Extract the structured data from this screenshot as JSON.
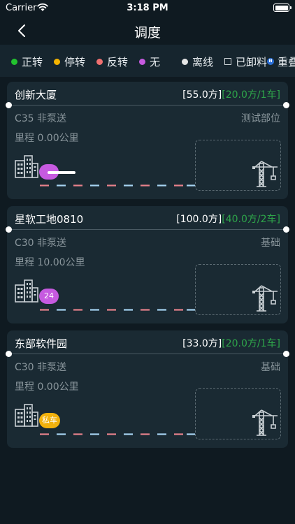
{
  "status_bar": {
    "carrier": "Carrier",
    "time": "3:18 PM"
  },
  "nav": {
    "title": "调度"
  },
  "legend": {
    "items": [
      {
        "label": "正转",
        "color": "#22c22e"
      },
      {
        "label": "停转",
        "color": "#f5b400"
      },
      {
        "label": "反转",
        "color": "#f07070"
      },
      {
        "label": "无",
        "color": "#c65ae0"
      },
      {
        "label": "离线",
        "color": "#e6e6e6"
      },
      {
        "label": "已卸料"
      },
      {
        "label": "重叠",
        "icon_text": "N"
      }
    ]
  },
  "sites": [
    {
      "name": "创新大厦",
      "amount_total": "[55.0方]",
      "amount_sent": "[20.0方/1车]",
      "grade": "C35 非泵送",
      "part": "测试部位",
      "mileage": "里程 0.00公里",
      "badge": {
        "text": "",
        "color": "#c65ae0"
      }
    },
    {
      "name": "星软工地0810",
      "amount_total": "[100.0方]",
      "amount_sent": "[40.0方/2车]",
      "grade": "C30 非泵送",
      "part": "基础",
      "mileage": "里程 10.00公里",
      "badge": {
        "text": "24",
        "color": "#c65ae0"
      }
    },
    {
      "name": "东部软件园",
      "amount_total": "[33.0方]",
      "amount_sent": "[20.0方/1车]",
      "grade": "C30 非泵送",
      "part": "基础",
      "mileage": "里程 0.00公里",
      "badge": {
        "text": "私车",
        "color": "#f2b10c"
      }
    }
  ],
  "colors": {
    "background": "#0f1a21",
    "card": "#1a2a33",
    "legend_bar": "#16252e",
    "accent_green": "#2ea54a",
    "muted_text": "#8a969c"
  }
}
